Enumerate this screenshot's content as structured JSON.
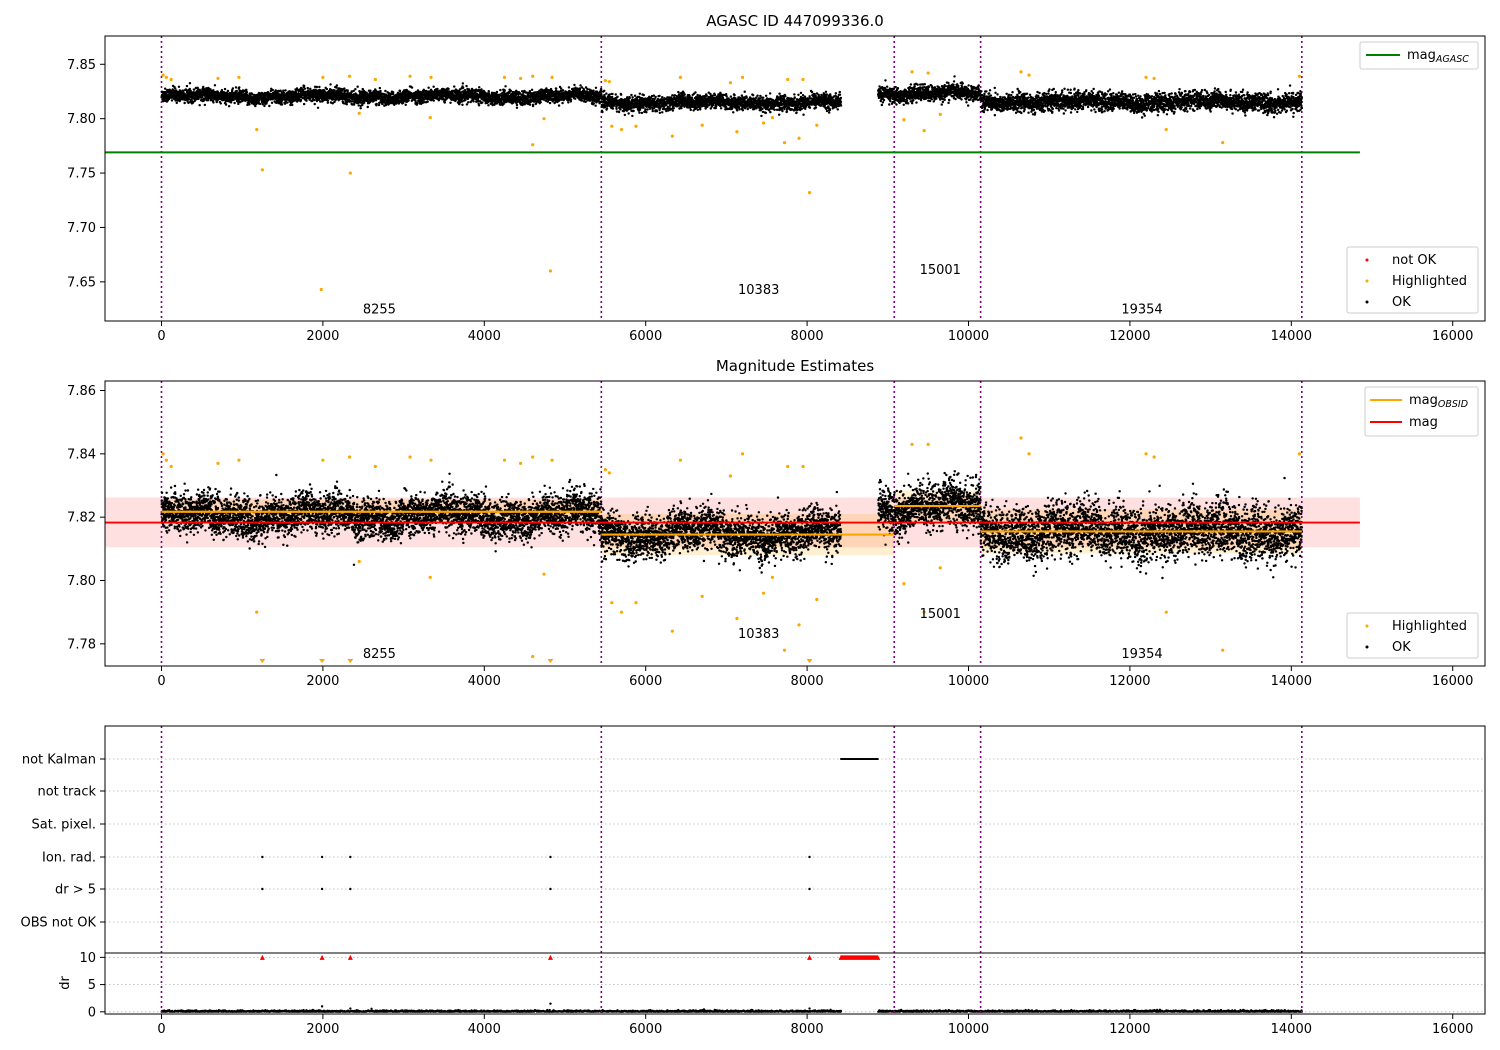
{
  "chart_data": [
    {
      "type": "scatter",
      "title": "AGASC ID 447099336.0",
      "xlim": [
        -700,
        16400
      ],
      "ylim": [
        7.614,
        7.876
      ],
      "x_ticks": [
        0,
        2000,
        4000,
        6000,
        8000,
        10000,
        12000,
        14000,
        16000
      ],
      "y_ticks": [
        7.65,
        7.7,
        7.75,
        7.8,
        7.85
      ],
      "y_tick_labels": [
        "7.65",
        "7.70",
        "7.75",
        "7.80",
        "7.85"
      ],
      "grid": false,
      "obsid_boundaries": [
        0,
        5450,
        9080,
        10150,
        14130
      ],
      "segments": [
        {
          "x0": 0,
          "x1": 5450,
          "level": 7.8205,
          "noise": 0.0055
        },
        {
          "x0": 5450,
          "x1": 8420,
          "level": 7.8148,
          "noise": 0.006
        },
        {
          "x0": 8880,
          "x1": 10150,
          "level": 7.823,
          "noise": 0.0065
        },
        {
          "x0": 10150,
          "x1": 14130,
          "level": 7.8155,
          "noise": 0.0075
        }
      ],
      "agasc_mag": {
        "value": 7.769,
        "x0": -700,
        "x1": 14850,
        "color": "#008000"
      },
      "highlighted_points": [
        [
          20,
          7.84
        ],
        [
          60,
          7.838
        ],
        [
          120,
          7.836
        ],
        [
          700,
          7.837
        ],
        [
          960,
          7.838
        ],
        [
          1180,
          7.79
        ],
        [
          1250,
          7.753
        ],
        [
          1980,
          7.643
        ],
        [
          2000,
          7.838
        ],
        [
          2330,
          7.839
        ],
        [
          2340,
          7.75
        ],
        [
          2450,
          7.805
        ],
        [
          2650,
          7.836
        ],
        [
          3080,
          7.839
        ],
        [
          3330,
          7.801
        ],
        [
          3340,
          7.838
        ],
        [
          4250,
          7.838
        ],
        [
          4450,
          7.837
        ],
        [
          4600,
          7.776
        ],
        [
          4600,
          7.839
        ],
        [
          4740,
          7.8
        ],
        [
          4820,
          7.66
        ],
        [
          4840,
          7.838
        ],
        [
          5500,
          7.835
        ],
        [
          5550,
          7.834
        ],
        [
          5580,
          7.793
        ],
        [
          5700,
          7.79
        ],
        [
          5880,
          7.793
        ],
        [
          6330,
          7.784
        ],
        [
          6430,
          7.838
        ],
        [
          6700,
          7.794
        ],
        [
          7050,
          7.833
        ],
        [
          7130,
          7.788
        ],
        [
          7200,
          7.838
        ],
        [
          7460,
          7.796
        ],
        [
          7570,
          7.801
        ],
        [
          7720,
          7.778
        ],
        [
          7760,
          7.836
        ],
        [
          7900,
          7.782
        ],
        [
          7950,
          7.836
        ],
        [
          8030,
          7.732
        ],
        [
          8120,
          7.794
        ],
        [
          9200,
          7.799
        ],
        [
          9300,
          7.843
        ],
        [
          9450,
          7.789
        ],
        [
          9500,
          7.842
        ],
        [
          9650,
          7.804
        ],
        [
          10650,
          7.843
        ],
        [
          10750,
          7.84
        ],
        [
          12200,
          7.838
        ],
        [
          12300,
          7.837
        ],
        [
          12450,
          7.79
        ],
        [
          13150,
          7.778
        ],
        [
          14100,
          7.839
        ]
      ],
      "annotations": [
        {
          "text": "8255",
          "x": 2700,
          "y": 7.621
        },
        {
          "text": "10383",
          "x": 7400,
          "y": 7.639
        },
        {
          "text": "15001",
          "x": 9650,
          "y": 7.657
        },
        {
          "text": "19354",
          "x": 12150,
          "y": 7.621
        }
      ],
      "legend_top": [
        {
          "label": "mag",
          "sub": "AGASC",
          "color": "#008000",
          "kind": "line"
        }
      ],
      "legend_bottom": [
        {
          "label": "not OK",
          "color": "#ff0000"
        },
        {
          "label": "Highlighted",
          "color": "#ffa500"
        },
        {
          "label": "OK",
          "color": "#000000"
        }
      ]
    },
    {
      "type": "scatter",
      "title": "Magnitude Estimates",
      "xlim": [
        -700,
        16400
      ],
      "ylim": [
        7.773,
        7.863
      ],
      "x_ticks": [
        0,
        2000,
        4000,
        6000,
        8000,
        10000,
        12000,
        14000,
        16000
      ],
      "y_ticks": [
        7.78,
        7.8,
        7.82,
        7.84,
        7.86
      ],
      "y_tick_labels": [
        "7.78",
        "7.80",
        "7.82",
        "7.84",
        "7.86"
      ],
      "grid": false,
      "obsid_boundaries": [
        0,
        5450,
        9080,
        10150,
        14130
      ],
      "segments": [
        {
          "x0": 0,
          "x1": 5450,
          "level": 7.8205,
          "noise": 0.0055
        },
        {
          "x0": 5450,
          "x1": 8420,
          "level": 7.8148,
          "noise": 0.006
        },
        {
          "x0": 8880,
          "x1": 10150,
          "level": 7.823,
          "noise": 0.0065
        },
        {
          "x0": 10150,
          "x1": 14130,
          "level": 7.8155,
          "noise": 0.0075
        }
      ],
      "mag": {
        "value": 7.8183,
        "band_low": 7.8105,
        "band_high": 7.8262,
        "x0": -700,
        "x1": 14850,
        "color": "#ff0000"
      },
      "mag_obsid": [
        {
          "x0": 0,
          "x1": 5450,
          "value": 7.8217,
          "low": 7.818,
          "high": 7.8255
        },
        {
          "x0": 5450,
          "x1": 9080,
          "value": 7.8145,
          "low": 7.808,
          "high": 7.821
        },
        {
          "x0": 9080,
          "x1": 10150,
          "value": 7.8235,
          "low": 7.8185,
          "high": 7.8285
        },
        {
          "x0": 10150,
          "x1": 14130,
          "value": 7.8155,
          "low": 7.8085,
          "high": 7.8225
        }
      ],
      "highlighted_points": [
        [
          20,
          7.84
        ],
        [
          60,
          7.838
        ],
        [
          120,
          7.836
        ],
        [
          700,
          7.837
        ],
        [
          960,
          7.838
        ],
        [
          1180,
          7.79
        ],
        [
          2000,
          7.838
        ],
        [
          2330,
          7.839
        ],
        [
          2450,
          7.806
        ],
        [
          2650,
          7.836
        ],
        [
          3080,
          7.839
        ],
        [
          3330,
          7.801
        ],
        [
          3340,
          7.838
        ],
        [
          4250,
          7.838
        ],
        [
          4450,
          7.837
        ],
        [
          4600,
          7.776
        ],
        [
          4600,
          7.839
        ],
        [
          4740,
          7.802
        ],
        [
          4840,
          7.838
        ],
        [
          5500,
          7.835
        ],
        [
          5550,
          7.834
        ],
        [
          5580,
          7.793
        ],
        [
          5700,
          7.79
        ],
        [
          5880,
          7.793
        ],
        [
          6330,
          7.784
        ],
        [
          6430,
          7.838
        ],
        [
          6700,
          7.795
        ],
        [
          7050,
          7.833
        ],
        [
          7130,
          7.788
        ],
        [
          7200,
          7.84
        ],
        [
          7460,
          7.796
        ],
        [
          7570,
          7.801
        ],
        [
          7720,
          7.778
        ],
        [
          7760,
          7.836
        ],
        [
          7900,
          7.786
        ],
        [
          7950,
          7.836
        ],
        [
          8120,
          7.794
        ],
        [
          9200,
          7.799
        ],
        [
          9300,
          7.843
        ],
        [
          9450,
          7.79
        ],
        [
          9500,
          7.843
        ],
        [
          9650,
          7.804
        ],
        [
          10650,
          7.845
        ],
        [
          10750,
          7.84
        ],
        [
          12200,
          7.84
        ],
        [
          12300,
          7.839
        ],
        [
          12450,
          7.79
        ],
        [
          13150,
          7.778
        ],
        [
          14100,
          7.84
        ]
      ],
      "offscale_markers_x": [
        1250,
        1990,
        2340,
        4820,
        8030
      ],
      "annotations": [
        {
          "text": "8255",
          "x": 2700,
          "y": 7.7755
        },
        {
          "text": "10383",
          "x": 7400,
          "y": 7.7818
        },
        {
          "text": "15001",
          "x": 9650,
          "y": 7.7882
        },
        {
          "text": "19354",
          "x": 12150,
          "y": 7.7755
        }
      ],
      "legend_top": [
        {
          "label": "mag",
          "sub": "OBSID",
          "color": "#ffa500",
          "kind": "line"
        },
        {
          "label": "mag",
          "sub": "",
          "color": "#ff0000",
          "kind": "line"
        }
      ],
      "legend_bottom": [
        {
          "label": "Highlighted",
          "color": "#ffa500"
        },
        {
          "label": "OK",
          "color": "#000000"
        }
      ]
    },
    {
      "type": "scatter",
      "title": "",
      "xlim": [
        -700,
        16400
      ],
      "x_ticks": [
        0,
        2000,
        4000,
        6000,
        8000,
        10000,
        12000,
        14000,
        16000
      ],
      "obsid_boundaries": [
        0,
        5450,
        9080,
        10150,
        14130
      ],
      "flag_rows": [
        "not Kalman",
        "not track",
        "Sat. pixel.",
        "Ion. rad.",
        "dr > 5",
        "OBS not OK"
      ],
      "flag_points": {
        "not Kalman": {
          "x0": 8420,
          "x1": 8880
        },
        "not track": null,
        "Sat. pixel.": null,
        "Ion. rad.": [
          1250,
          1990,
          2340,
          4820,
          8030
        ],
        "dr > 5": [
          1250,
          1990,
          2340,
          4820,
          8030
        ],
        "OBS not OK": null
      },
      "dr_ylabel": "dr",
      "dr_ylim": [
        -0.4,
        10.8
      ],
      "dr_ticks": [
        0,
        5,
        10
      ],
      "dr_tick_labels": [
        "0",
        "5",
        "10"
      ],
      "dr_capped_markers_x": [
        1250,
        1990,
        2340,
        4820,
        8030
      ],
      "dr_capped_range": {
        "x0": 8420,
        "x1": 8880
      },
      "dr_spikes": [
        [
          1990,
          1.0
        ],
        [
          4820,
          1.5
        ],
        [
          2340,
          0.6
        ],
        [
          8030,
          0.6
        ]
      ],
      "dr_segments": [
        [
          0,
          5450
        ],
        [
          5450,
          8420
        ],
        [
          8880,
          10150
        ],
        [
          10150,
          14130
        ]
      ]
    }
  ]
}
